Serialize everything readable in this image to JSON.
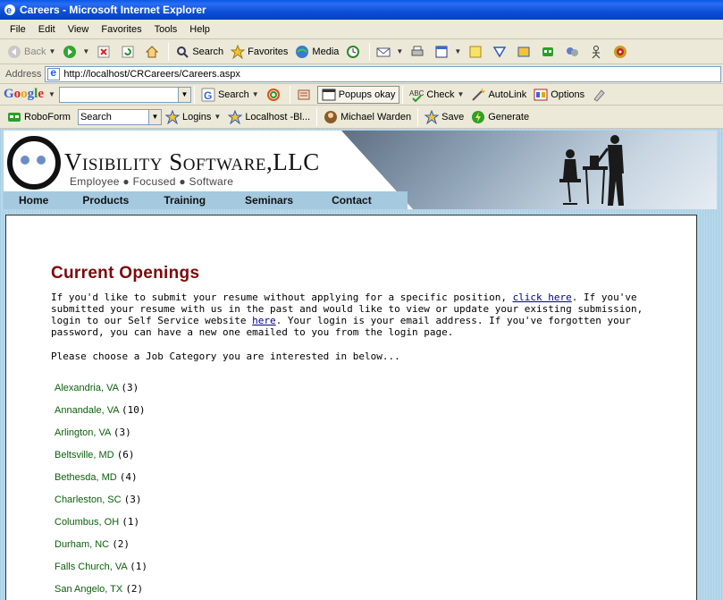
{
  "window": {
    "title": "Careers - Microsoft Internet Explorer"
  },
  "menu": [
    "File",
    "Edit",
    "View",
    "Favorites",
    "Tools",
    "Help"
  ],
  "toolbar": {
    "back": "Back",
    "search": "Search",
    "favorites": "Favorites",
    "media": "Media"
  },
  "address": {
    "label": "Address",
    "url": "http://localhost/CRCareers/Careers.aspx"
  },
  "google_toolbar": {
    "logo": "Google",
    "search": "Search",
    "popups": "Popups okay",
    "check": "Check",
    "autolink": "AutoLink",
    "options": "Options"
  },
  "roboform_toolbar": {
    "name": "RoboForm",
    "search_value": "Search",
    "logins": "Logins",
    "localhost": "Localhost -Bl...",
    "user": "Michael Warden",
    "save": "Save",
    "generate": "Generate"
  },
  "site": {
    "logo_name": "Visibility Software,LLC",
    "tagline": "Employee ● Focused ● Software",
    "nav": [
      "Home",
      "Products",
      "Training",
      "Seminars",
      "Contact"
    ]
  },
  "page": {
    "title": "Current Openings",
    "para1_a": "If you'd like to submit your resume without applying for a specific position, ",
    "link_click_here": "click here",
    "para1_b": ". If you've submitted your resume with us in the past and would like to view or update your existing submission, login to our Self Service website ",
    "link_here": "here",
    "para1_c": ". Your login is your email address. If you've forgotten your password, you can have a new one emailed to you from the login page.",
    "choose": "Please choose a Job Category you are interested in below..."
  },
  "categories": [
    {
      "city": "Alexandria, VA",
      "count": "(3)"
    },
    {
      "city": "Annandale, VA",
      "count": "(10)"
    },
    {
      "city": "Arlington, VA",
      "count": "(3)"
    },
    {
      "city": "Beltsville, MD",
      "count": "(6)"
    },
    {
      "city": "Bethesda, MD",
      "count": "(4)"
    },
    {
      "city": "Charleston, SC",
      "count": "(3)"
    },
    {
      "city": "Columbus, OH",
      "count": "(1)"
    },
    {
      "city": "Durham, NC",
      "count": "(2)"
    },
    {
      "city": "Falls Church, VA",
      "count": "(1)"
    },
    {
      "city": "San Angelo, TX",
      "count": "(2)"
    }
  ]
}
